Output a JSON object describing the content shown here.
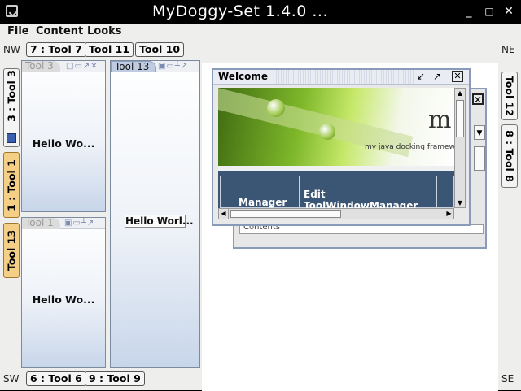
{
  "window": {
    "title": "MyDoggy-Set 1.4.0 ..."
  },
  "menubar": {
    "items": [
      "File",
      "Content",
      "Looks"
    ]
  },
  "corners": {
    "nw": "NW",
    "ne": "NE",
    "sw": "SW",
    "se": "SE"
  },
  "top_bar": {
    "buttons": [
      "7 : Tool 7",
      "Tool 11",
      "Tool 10"
    ]
  },
  "bottom_bar": {
    "buttons": [
      "6 : Tool 6",
      "9 : Tool 9"
    ]
  },
  "left_bar": {
    "buttons": [
      "3 : Tool 3",
      "1 : Tool 1",
      "Tool 13"
    ]
  },
  "right_bar": {
    "buttons": [
      "Tool 12",
      "8 : Tool 8"
    ]
  },
  "panels": {
    "tool3": {
      "tab": "Tool 3",
      "content": "Hello Wo..."
    },
    "tool1": {
      "tab": "Tool 1",
      "content": "Hello Wo..."
    },
    "tool13": {
      "tab": "Tool 13",
      "content": "Hello Worl..."
    }
  },
  "welcome": {
    "title": "Welcome",
    "banner_text": "my java docking framework",
    "banner_letter": "m",
    "cells": [
      "Manager",
      "Edit ToolWindowManager"
    ]
  },
  "back_frame": {
    "label": "Contents"
  }
}
